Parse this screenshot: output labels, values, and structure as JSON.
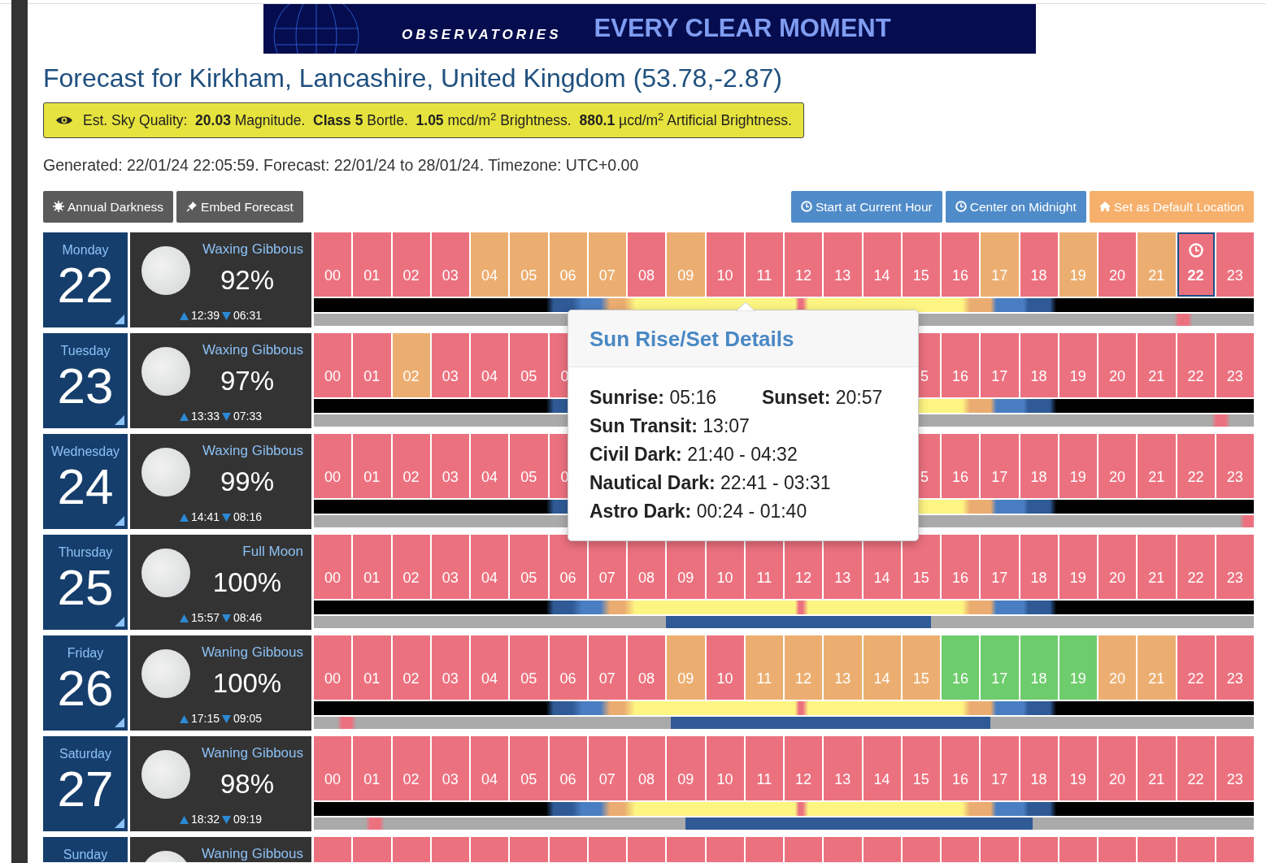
{
  "banner": {
    "brand": "OBSERVATORIES",
    "slogan": "EVERY CLEAR MOMENT"
  },
  "title": "Forecast for Kirkham, Lancashire, United Kingdom (53.78,-2.87)",
  "sky_quality": "Est. Sky Quality:  **20.03** Magnitude.  **Class 5** Bortle.  **1.05** mcd/m$^{2}$ Brightness.  **880.1** µcd/m$^{2}$ Artificial Brightness.",
  "generated": "Generated: 22/01/24 22:05:59. Forecast: 22/01/24 to 28/01/24. Timezone: UTC+0.00",
  "buttons": [
    {
      "label": "Annual Darkness",
      "kind": "dark"
    },
    {
      "label": "Embed Forecast",
      "kind": "dark"
    },
    {
      "label": "Start at Current Hour",
      "kind": "blue"
    },
    {
      "label": "Center on Midnight",
      "kind": "blue"
    },
    {
      "label": "Set as Default Location",
      "kind": "orange"
    }
  ],
  "days": [
    {
      "weekday": "Monday",
      "date": "22",
      "phase": "Waxing Gibbous",
      "illumination": "92%",
      "moonrise": "12:39",
      "moonset": "06:31",
      "hours": [
        {
          "label": "00",
          "color": "#ec717f",
          "current": false
        },
        {
          "label": "01",
          "color": "#ec717f",
          "current": false
        },
        {
          "label": "02",
          "color": "#ec717f",
          "current": false
        },
        {
          "label": "03",
          "color": "#ec717f",
          "current": false
        },
        {
          "label": "04",
          "color": "#ecae70",
          "current": false
        },
        {
          "label": "05",
          "color": "#ecae70",
          "current": false
        },
        {
          "label": "06",
          "color": "#ecae70",
          "current": false
        },
        {
          "label": "07",
          "color": "#ecae70",
          "current": false
        },
        {
          "label": "08",
          "color": "#ec717f",
          "current": false
        },
        {
          "label": "09",
          "color": "#ecae70",
          "current": false
        },
        {
          "label": "10",
          "color": "#ec717f",
          "current": false
        },
        {
          "label": "11",
          "color": "#ec717f",
          "current": false
        },
        {
          "label": "12",
          "color": "#ec717f",
          "current": false
        },
        {
          "label": "13",
          "color": "#ec717f",
          "current": false
        },
        {
          "label": "14",
          "color": "#ec717f",
          "current": false
        },
        {
          "label": "15",
          "color": "#ec717f",
          "current": false
        },
        {
          "label": "16",
          "color": "#ec717f",
          "current": false
        },
        {
          "label": "17",
          "color": "#ecae70",
          "current": false
        },
        {
          "label": "18",
          "color": "#ec717f",
          "current": false
        },
        {
          "label": "19",
          "color": "#ecae70",
          "current": false
        },
        {
          "label": "20",
          "color": "#ec717f",
          "current": false
        },
        {
          "label": "21",
          "color": "#ecae70",
          "current": false
        },
        {
          "label": "22",
          "color": "#ec717f",
          "current": true
        },
        {
          "label": "23",
          "color": "#ec717f",
          "current": false
        }
      ]
    },
    {
      "weekday": "Tuesday",
      "date": "23",
      "phase": "Waxing Gibbous",
      "illumination": "97%",
      "moonrise": "13:33",
      "moonset": "07:33",
      "hours": [
        {
          "label": "00",
          "color": "#ec717f",
          "current": false
        },
        {
          "label": "01",
          "color": "#ec717f",
          "current": false
        },
        {
          "label": "02",
          "color": "#ecae70",
          "current": false
        },
        {
          "label": "03",
          "color": "#ec717f",
          "current": false
        },
        {
          "label": "04",
          "color": "#ec717f",
          "current": false
        },
        {
          "label": "05",
          "color": "#ec717f",
          "current": false
        },
        {
          "label": "0",
          "color": "#ec717f",
          "current": false
        }
      ],
      "hours_end": [
        {
          "label": "5",
          "color": "#ec717f",
          "current": false
        },
        {
          "label": "16",
          "color": "#ec717f",
          "current": false
        },
        {
          "label": "17",
          "color": "#ec717f",
          "current": false
        },
        {
          "label": "18",
          "color": "#ec717f",
          "current": false
        },
        {
          "label": "19",
          "color": "#ec717f",
          "current": false
        },
        {
          "label": "20",
          "color": "#ec717f",
          "current": false
        },
        {
          "label": "21",
          "color": "#ec717f",
          "current": false
        },
        {
          "label": "22",
          "color": "#ec717f",
          "current": false
        },
        {
          "label": "23",
          "color": "#ec717f",
          "current": false
        }
      ]
    },
    {
      "weekday": "Wednesday",
      "date": "24",
      "phase": "Waxing Gibbous",
      "illumination": "99%",
      "moonrise": "14:41",
      "moonset": "08:16",
      "hours": [
        {
          "label": "00",
          "color": "#ec717f",
          "current": false
        },
        {
          "label": "01",
          "color": "#ec717f",
          "current": false
        },
        {
          "label": "02",
          "color": "#ec717f",
          "current": false
        },
        {
          "label": "03",
          "color": "#ec717f",
          "current": false
        },
        {
          "label": "04",
          "color": "#ec717f",
          "current": false
        },
        {
          "label": "05",
          "color": "#ec717f",
          "current": false
        },
        {
          "label": "0",
          "color": "#ec717f",
          "current": false
        }
      ],
      "hours_end": [
        {
          "label": "5",
          "color": "#ec717f",
          "current": false
        },
        {
          "label": "16",
          "color": "#ec717f",
          "current": false
        },
        {
          "label": "17",
          "color": "#ec717f",
          "current": false
        },
        {
          "label": "18",
          "color": "#ec717f",
          "current": false
        },
        {
          "label": "19",
          "color": "#ec717f",
          "current": false
        },
        {
          "label": "20",
          "color": "#ec717f",
          "current": false
        },
        {
          "label": "21",
          "color": "#ec717f",
          "current": false
        },
        {
          "label": "22",
          "color": "#ec717f",
          "current": false
        },
        {
          "label": "23",
          "color": "#ec717f",
          "current": false
        }
      ]
    },
    {
      "weekday": "Thursday",
      "date": "25",
      "phase": "Full Moon",
      "illumination": "100%",
      "moonrise": "15:57",
      "moonset": "08:46",
      "hours": [
        {
          "label": "00",
          "color": "#ec717f",
          "current": false
        },
        {
          "label": "01",
          "color": "#ec717f",
          "current": false
        },
        {
          "label": "02",
          "color": "#ec717f",
          "current": false
        },
        {
          "label": "03",
          "color": "#ec717f",
          "current": false
        },
        {
          "label": "04",
          "color": "#ec717f",
          "current": false
        },
        {
          "label": "05",
          "color": "#ec717f",
          "current": false
        },
        {
          "label": "06",
          "color": "#ec717f",
          "current": false
        },
        {
          "label": "07",
          "color": "#ec717f",
          "current": false
        },
        {
          "label": "08",
          "color": "#ec717f",
          "current": false
        },
        {
          "label": "09",
          "color": "#ec717f",
          "current": false
        },
        {
          "label": "10",
          "color": "#ec717f",
          "current": false
        },
        {
          "label": "11",
          "color": "#ec717f",
          "current": false
        },
        {
          "label": "12",
          "color": "#ec717f",
          "current": false
        },
        {
          "label": "13",
          "color": "#ec717f",
          "current": false
        },
        {
          "label": "14",
          "color": "#ec717f",
          "current": false
        },
        {
          "label": "15",
          "color": "#ec717f",
          "current": false
        },
        {
          "label": "16",
          "color": "#ec717f",
          "current": false
        },
        {
          "label": "17",
          "color": "#ec717f",
          "current": false
        },
        {
          "label": "18",
          "color": "#ec717f",
          "current": false
        },
        {
          "label": "19",
          "color": "#ec717f",
          "current": false
        },
        {
          "label": "20",
          "color": "#ec717f",
          "current": false
        },
        {
          "label": "21",
          "color": "#ec717f",
          "current": false
        },
        {
          "label": "22",
          "color": "#ec717f",
          "current": false
        },
        {
          "label": "23",
          "color": "#ec717f",
          "current": false
        }
      ]
    },
    {
      "weekday": "Friday",
      "date": "26",
      "phase": "Waning Gibbous",
      "illumination": "100%",
      "moonrise": "17:15",
      "moonset": "09:05",
      "hours": [
        {
          "label": "00",
          "color": "#ec717f",
          "current": false
        },
        {
          "label": "01",
          "color": "#ec717f",
          "current": false
        },
        {
          "label": "02",
          "color": "#ec717f",
          "current": false
        },
        {
          "label": "03",
          "color": "#ec717f",
          "current": false
        },
        {
          "label": "04",
          "color": "#ec717f",
          "current": false
        },
        {
          "label": "05",
          "color": "#ec717f",
          "current": false
        },
        {
          "label": "06",
          "color": "#ec717f",
          "current": false
        },
        {
          "label": "07",
          "color": "#ec717f",
          "current": false
        },
        {
          "label": "08",
          "color": "#ec717f",
          "current": false
        },
        {
          "label": "09",
          "color": "#ecae70",
          "current": false
        },
        {
          "label": "10",
          "color": "#ec717f",
          "current": false
        },
        {
          "label": "11",
          "color": "#ecae70",
          "current": false
        },
        {
          "label": "12",
          "color": "#ecae70",
          "current": false
        },
        {
          "label": "13",
          "color": "#ecae70",
          "current": false
        },
        {
          "label": "14",
          "color": "#ecae70",
          "current": false
        },
        {
          "label": "15",
          "color": "#ecae70",
          "current": false
        },
        {
          "label": "16",
          "color": "#6dcc6c",
          "current": false
        },
        {
          "label": "17",
          "color": "#6dcc6c",
          "current": false
        },
        {
          "label": "18",
          "color": "#6dcc6c",
          "current": false
        },
        {
          "label": "19",
          "color": "#6dcc6c",
          "current": false
        },
        {
          "label": "20",
          "color": "#ecae70",
          "current": false
        },
        {
          "label": "21",
          "color": "#ecae70",
          "current": false
        },
        {
          "label": "22",
          "color": "#ec717f",
          "current": false
        },
        {
          "label": "23",
          "color": "#ec717f",
          "current": false
        }
      ]
    },
    {
      "weekday": "Saturday",
      "date": "27",
      "phase": "Waning Gibbous",
      "illumination": "98%",
      "moonrise": "18:32",
      "moonset": "09:19",
      "hours": [
        {
          "label": "00",
          "color": "#ec717f",
          "current": false
        },
        {
          "label": "01",
          "color": "#ec717f",
          "current": false
        },
        {
          "label": "02",
          "color": "#ec717f",
          "current": false
        },
        {
          "label": "03",
          "color": "#ec717f",
          "current": false
        },
        {
          "label": "04",
          "color": "#ec717f",
          "current": false
        },
        {
          "label": "05",
          "color": "#ec717f",
          "current": false
        },
        {
          "label": "06",
          "color": "#ec717f",
          "current": false
        },
        {
          "label": "07",
          "color": "#ec717f",
          "current": false
        },
        {
          "label": "08",
          "color": "#ec717f",
          "current": false
        },
        {
          "label": "09",
          "color": "#ec717f",
          "current": false
        },
        {
          "label": "10",
          "color": "#ec717f",
          "current": false
        },
        {
          "label": "11",
          "color": "#ec717f",
          "current": false
        },
        {
          "label": "12",
          "color": "#ec717f",
          "current": false
        },
        {
          "label": "13",
          "color": "#ec717f",
          "current": false
        },
        {
          "label": "14",
          "color": "#ec717f",
          "current": false
        },
        {
          "label": "15",
          "color": "#ec717f",
          "current": false
        },
        {
          "label": "16",
          "color": "#ec717f",
          "current": false
        },
        {
          "label": "17",
          "color": "#ec717f",
          "current": false
        },
        {
          "label": "18",
          "color": "#ec717f",
          "current": false
        },
        {
          "label": "19",
          "color": "#ec717f",
          "current": false
        },
        {
          "label": "20",
          "color": "#ec717f",
          "current": false
        },
        {
          "label": "21",
          "color": "#ec717f",
          "current": false
        },
        {
          "label": "22",
          "color": "#ec717f",
          "current": false
        },
        {
          "label": "23",
          "color": "#ec717f",
          "current": false
        }
      ]
    },
    {
      "weekday": "Sunday",
      "phase": "Waning Gibbous",
      "hours": [
        {
          "color": "#ec717f",
          "current": false
        },
        {
          "color": "#ec717f",
          "current": false
        },
        {
          "color": "#ec717f",
          "current": false
        },
        {
          "color": "#ec717f",
          "current": false
        },
        {
          "color": "#ec717f",
          "current": false
        },
        {
          "color": "#ec717f",
          "current": false
        },
        {
          "color": "#ec717f",
          "current": false
        },
        {
          "color": "#ec717f",
          "current": false
        },
        {
          "color": "#ec717f",
          "current": false
        },
        {
          "color": "#ec717f",
          "current": false
        },
        {
          "color": "#ec717f",
          "current": false
        },
        {
          "color": "#ec717f",
          "current": false
        },
        {
          "color": "#ec717f",
          "current": false
        },
        {
          "color": "#ec717f",
          "current": false
        },
        {
          "color": "#ec717f",
          "current": false
        },
        {
          "color": "#ec717f",
          "current": false
        },
        {
          "color": "#ec717f",
          "current": false
        },
        {
          "color": "#ec717f",
          "current": false
        },
        {
          "color": "#ec717f",
          "current": false
        },
        {
          "color": "#ec717f",
          "current": false
        },
        {
          "color": "#ec717f",
          "current": false
        },
        {
          "color": "#ec717f",
          "current": false
        },
        {
          "color": "#ec717f",
          "current": false
        },
        {
          "color": "#ec717f",
          "current": false
        }
      ]
    }
  ],
  "popup": {
    "title": "Sun Rise/Set Details",
    "rows": [
      [
        "**Sunrise:** 05:16",
        "**Sunset:** 20:57"
      ],
      [
        "**Sun Transit:** 13:07"
      ],
      [
        "**Civil Dark:** 21:40 - 04:32"
      ],
      [
        "**Nautical Dark:** 22:41 - 03:31"
      ],
      [
        "**Astro Dark:** 00:24 - 01:40"
      ]
    ]
  }
}
